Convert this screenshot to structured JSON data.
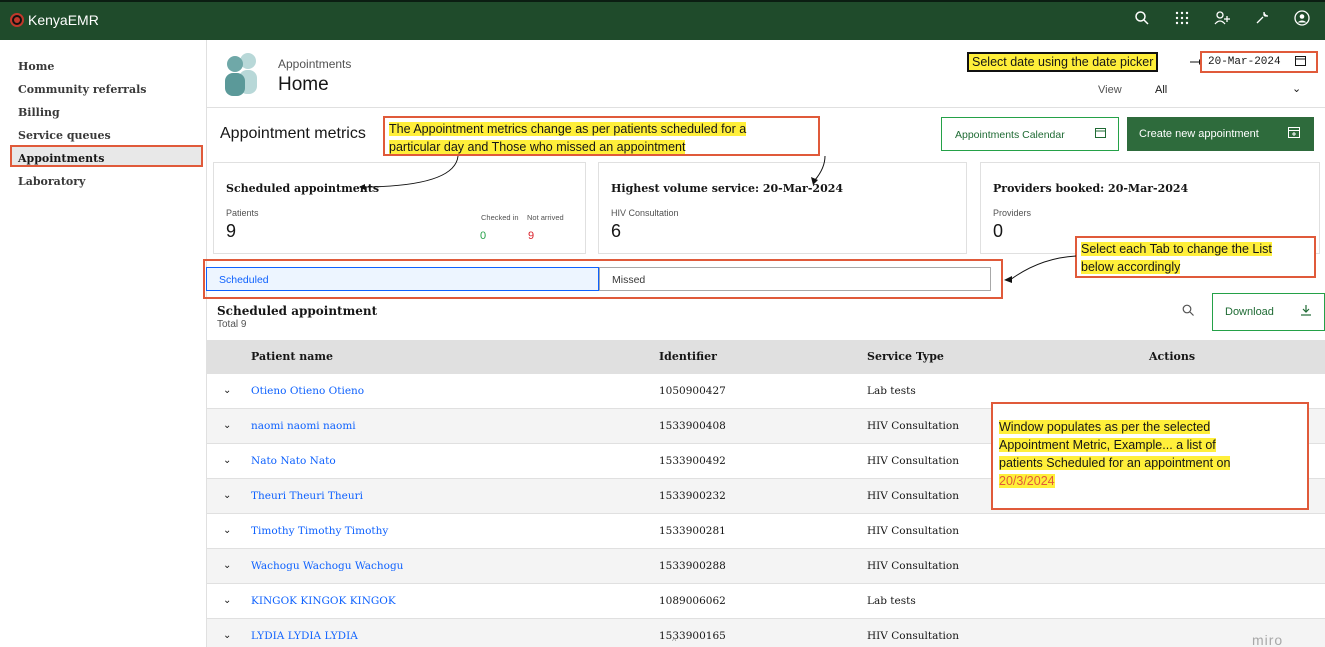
{
  "topbar": {
    "brand": "KenyaEMR",
    "icons": [
      "search-icon",
      "app-switcher-icon",
      "add-user-icon",
      "tools-icon",
      "user-avatar-icon"
    ]
  },
  "sidebar": {
    "items": [
      {
        "label": "Home"
      },
      {
        "label": "Community referrals"
      },
      {
        "label": "Billing"
      },
      {
        "label": "Service queues"
      },
      {
        "label": "Appointments",
        "active": true
      },
      {
        "label": "Laboratory"
      }
    ]
  },
  "header": {
    "subtitle": "Appointments",
    "title": "Home",
    "date": "20-Mar-2024",
    "view_label": "View",
    "view_value": "All"
  },
  "metrics": {
    "title": "Appointment metrics",
    "calendar_button": "Appointments Calendar",
    "create_button": "Create new appointment",
    "cards": [
      {
        "title": "Scheduled appointments",
        "label": "Patients",
        "value": "9",
        "checked_in_label": "Checked in",
        "not_arrived_label": "Not arrived",
        "checked_in": "0",
        "not_arrived": "9"
      },
      {
        "title": "Highest volume service: 20-Mar-2024",
        "label": "HIV Consultation",
        "value": "6"
      },
      {
        "title": "Providers booked: 20-Mar-2024",
        "label": "Providers",
        "value": "0"
      }
    ]
  },
  "tabs": [
    {
      "label": "Scheduled",
      "selected": true
    },
    {
      "label": "Missed",
      "selected": false
    }
  ],
  "table": {
    "title": "Scheduled appointment",
    "total": "Total 9",
    "download_label": "Download",
    "columns": [
      "Patient name",
      "Identifier",
      "Service Type",
      "Actions"
    ],
    "rows": [
      {
        "name": "Otieno Otieno Otieno",
        "identifier": "1050900427",
        "service": "Lab tests"
      },
      {
        "name": "naomi naomi naomi",
        "identifier": "1533900408",
        "service": "HIV Consultation"
      },
      {
        "name": "Nato Nato Nato",
        "identifier": "1533900492",
        "service": "HIV Consultation"
      },
      {
        "name": "Theuri Theuri Theuri",
        "identifier": "1533900232",
        "service": "HIV Consultation"
      },
      {
        "name": "Timothy Timothy Timothy",
        "identifier": "1533900281",
        "service": "HIV Consultation"
      },
      {
        "name": "Wachogu Wachogu Wachogu",
        "identifier": "1533900288",
        "service": "HIV Consultation"
      },
      {
        "name": "KINGOK KINGOK KINGOK",
        "identifier": "1089006062",
        "service": "Lab tests"
      },
      {
        "name": "LYDIA LYDIA LYDIA",
        "identifier": "1533900165",
        "service": "HIV Consultation"
      }
    ]
  },
  "annotations": {
    "date_picker": "Select date using the date picker",
    "metrics_line1": "The Appointment metrics change as per patients scheduled for a",
    "metrics_line2": "particular day and Those who missed an appointment",
    "tabs_line1": "Select each Tab to change the List",
    "tabs_line2": "below accordingly",
    "window_line1": "Window populates as per the selected",
    "window_line2": "Appointment Metric, Example... a list of",
    "window_line3": "patients Scheduled for an appointment on",
    "window_date": "20/3/2024"
  },
  "watermark": "miro",
  "colors": {
    "topbar": "#1f4b2b",
    "primary_green": "#2e6b3c",
    "link_blue": "#0f62fe",
    "annotation_border": "#e05a3a",
    "highlight": "#ffef3a",
    "checked_in_green": "#24a148",
    "not_arrived_red": "#da1e28"
  }
}
